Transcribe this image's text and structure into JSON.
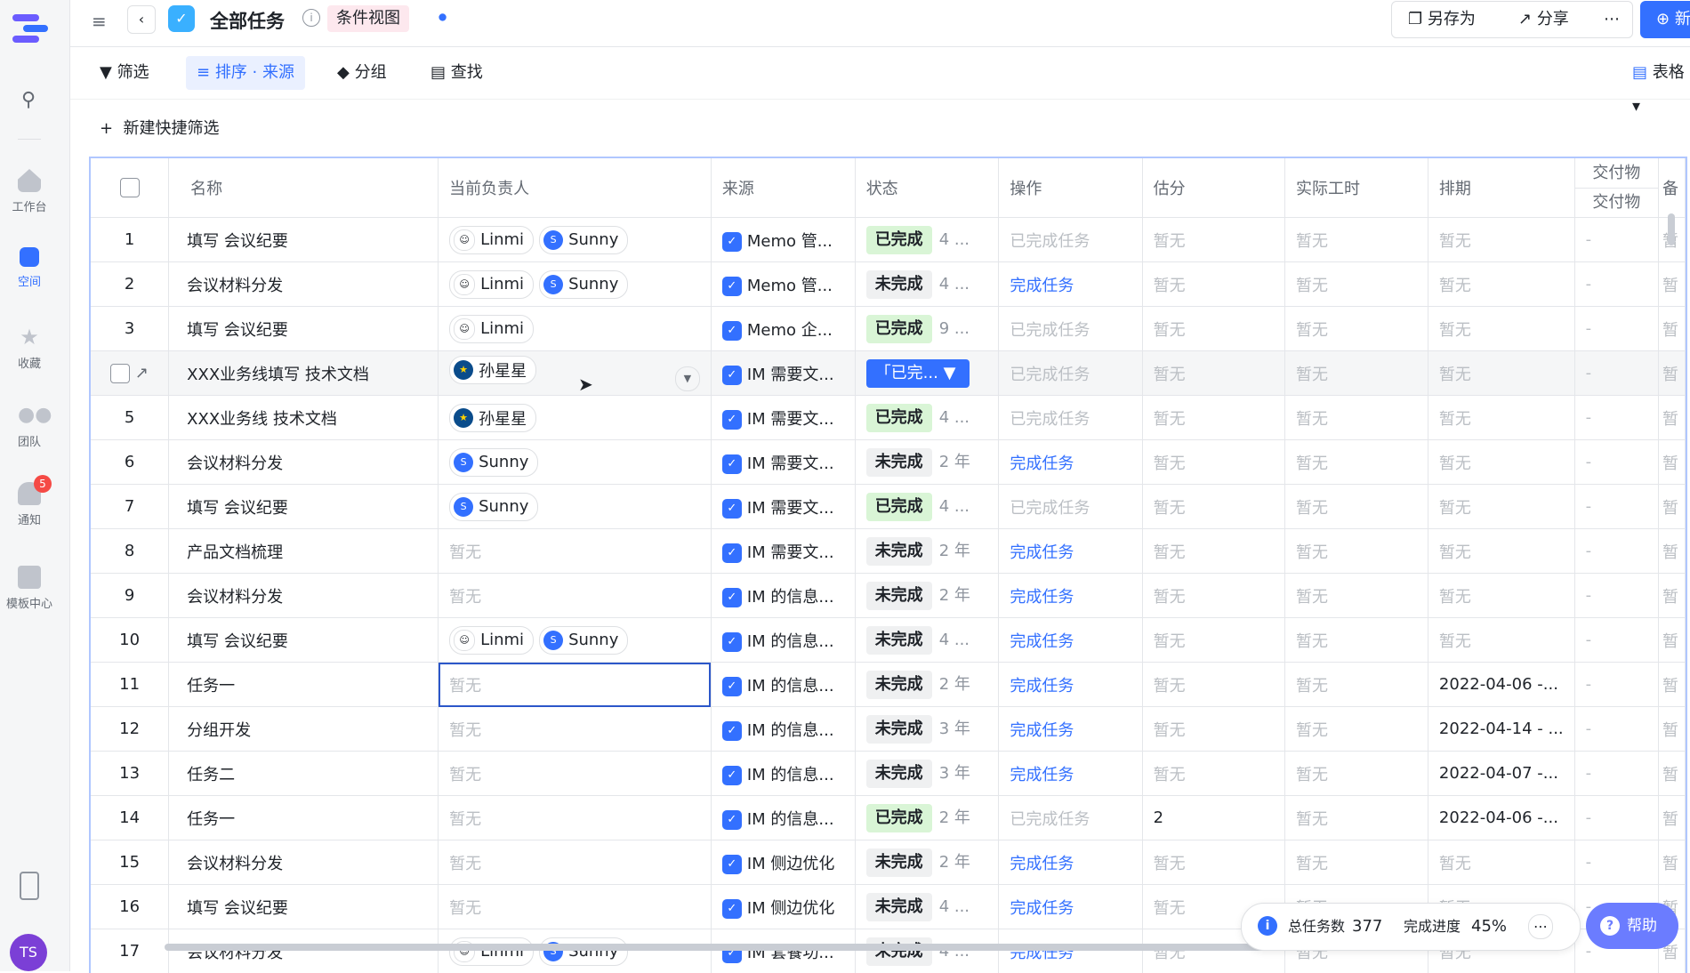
{
  "rail": {
    "items": [
      {
        "label": "工作台",
        "icon": "home-icon"
      },
      {
        "label": "空间",
        "icon": "space-icon"
      },
      {
        "label": "收藏",
        "icon": "star-icon"
      },
      {
        "label": "团队",
        "icon": "team-icon"
      },
      {
        "label": "通知",
        "icon": "bell-icon",
        "badge": "5"
      },
      {
        "label": "模板中心",
        "icon": "template-icon"
      }
    ],
    "avatar": "TS"
  },
  "topbar": {
    "title": "全部任务",
    "view_label": "条件视图",
    "save_as": "另存为",
    "share": "分享",
    "new": "新建"
  },
  "toolbar": {
    "filter": "筛选",
    "sort": "排序 · 来源",
    "group": "分组",
    "find": "查找",
    "view": "表格"
  },
  "quick_filter": "新建快捷筛选",
  "table": {
    "headers": {
      "name": "名称",
      "owner": "当前负责人",
      "source": "来源",
      "status": "状态",
      "action": "操作",
      "estimate": "估分",
      "actual": "实际工时",
      "schedule": "排期",
      "deliver_top": "交付物",
      "deliver_sub": "交付物",
      "extra": "备"
    },
    "rows": [
      {
        "n": "1",
        "name": "填写 会议纪要",
        "owners": [
          "Linmi",
          "Sunny"
        ],
        "source": "Memo 管...",
        "status": "已完成",
        "dur": "4 ...",
        "action": "已完成任务",
        "est": "暂无",
        "act": "暂无",
        "sched": "暂无",
        "deliv": "-",
        "extra": "暂"
      },
      {
        "n": "2",
        "name": "会议材料分发",
        "owners": [
          "Linmi",
          "Sunny"
        ],
        "source": "Memo 管...",
        "status": "未完成",
        "dur": "4 ...",
        "action": "完成任务",
        "est": "暂无",
        "act": "暂无",
        "sched": "暂无",
        "deliv": "-",
        "extra": "暂"
      },
      {
        "n": "3",
        "name": "填写 会议纪要",
        "owners": [
          "Linmi"
        ],
        "source": "Memo 企...",
        "status": "已完成",
        "dur": "9 ...",
        "action": "已完成任务",
        "est": "暂无",
        "act": "暂无",
        "sched": "暂无",
        "deliv": "-",
        "extra": "暂"
      },
      {
        "n": "",
        "name": "XXX业务线填写 技术文档",
        "owners": [
          "孙星星"
        ],
        "source": "IM 需要文...",
        "status": "「已完...",
        "dur": "",
        "action": "已完成任务",
        "est": "暂无",
        "act": "暂无",
        "sched": "暂无",
        "deliv": "-",
        "extra": "暂"
      },
      {
        "n": "5",
        "name": "XXX业务线 技术文档",
        "owners": [
          "孙星星"
        ],
        "source": "IM 需要文...",
        "status": "已完成",
        "dur": "4 ...",
        "action": "已完成任务",
        "est": "暂无",
        "act": "暂无",
        "sched": "暂无",
        "deliv": "-",
        "extra": "暂"
      },
      {
        "n": "6",
        "name": "会议材料分发",
        "owners": [
          "Sunny"
        ],
        "source": "IM 需要文...",
        "status": "未完成",
        "dur": "2 年",
        "action": "完成任务",
        "est": "暂无",
        "act": "暂无",
        "sched": "暂无",
        "deliv": "-",
        "extra": "暂"
      },
      {
        "n": "7",
        "name": "填写 会议纪要",
        "owners": [
          "Sunny"
        ],
        "source": "IM 需要文...",
        "status": "已完成",
        "dur": "4 ...",
        "action": "已完成任务",
        "est": "暂无",
        "act": "暂无",
        "sched": "暂无",
        "deliv": "-",
        "extra": "暂"
      },
      {
        "n": "8",
        "name": "产品文档梳理",
        "owners": [],
        "source": "IM 需要文...",
        "status": "未完成",
        "dur": "2 年",
        "action": "完成任务",
        "est": "暂无",
        "act": "暂无",
        "sched": "暂无",
        "deliv": "-",
        "extra": "暂"
      },
      {
        "n": "9",
        "name": "会议材料分发",
        "owners": [],
        "source": "IM 的信息...",
        "status": "未完成",
        "dur": "2 年",
        "action": "完成任务",
        "est": "暂无",
        "act": "暂无",
        "sched": "暂无",
        "deliv": "-",
        "extra": "暂"
      },
      {
        "n": "10",
        "name": "填写 会议纪要",
        "owners": [
          "Linmi",
          "Sunny"
        ],
        "source": "IM 的信息...",
        "status": "未完成",
        "dur": "4 ...",
        "action": "完成任务",
        "est": "暂无",
        "act": "暂无",
        "sched": "暂无",
        "deliv": "-",
        "extra": "暂"
      },
      {
        "n": "11",
        "name": "任务一",
        "owners": [],
        "source": "IM 的信息...",
        "status": "未完成",
        "dur": "2 年",
        "action": "完成任务",
        "est": "暂无",
        "act": "暂无",
        "sched": "2022-04-06 -...",
        "deliv": "-",
        "extra": "暂"
      },
      {
        "n": "12",
        "name": "分组开发",
        "owners": [],
        "source": "IM 的信息...",
        "status": "未完成",
        "dur": "3 年",
        "action": "完成任务",
        "est": "暂无",
        "act": "暂无",
        "sched": "2022-04-14 - ...",
        "deliv": "-",
        "extra": "暂"
      },
      {
        "n": "13",
        "name": "任务二",
        "owners": [],
        "source": "IM 的信息...",
        "status": "未完成",
        "dur": "3 年",
        "action": "完成任务",
        "est": "暂无",
        "act": "暂无",
        "sched": "2022-04-07 -...",
        "deliv": "-",
        "extra": "暂"
      },
      {
        "n": "14",
        "name": "任务一",
        "owners": [],
        "source": "IM 的信息...",
        "status": "已完成",
        "dur": "2 年",
        "action": "已完成任务",
        "est": "2",
        "act": "暂无",
        "sched": "2022-04-06 -...",
        "deliv": "-",
        "extra": "暂"
      },
      {
        "n": "15",
        "name": "会议材料分发",
        "owners": [],
        "source": "IM 侧边优化",
        "status": "未完成",
        "dur": "2 年",
        "action": "完成任务",
        "est": "暂无",
        "act": "暂无",
        "sched": "暂无",
        "deliv": "-",
        "extra": "暂"
      },
      {
        "n": "16",
        "name": "填写 会议纪要",
        "owners": [],
        "source": "IM 侧边优化",
        "status": "未完成",
        "dur": "4 ...",
        "action": "完成任务",
        "est": "暂无",
        "act": "暂无",
        "sched": "暂无",
        "deliv": "-",
        "extra": "暂"
      },
      {
        "n": "17",
        "name": "会议材料分发",
        "owners": [
          "Linmi",
          "Sunny"
        ],
        "source": "IM 套餐功...",
        "status": "未完成",
        "dur": "4 ...",
        "action": "完成任务",
        "est": "暂无",
        "act": "暂无",
        "sched": "暂无",
        "deliv": "-",
        "extra": "暂"
      }
    ],
    "empty_text": "暂无"
  },
  "stats": {
    "total_label": "总任务数",
    "total": "377",
    "progress_label": "完成进度",
    "progress": "45%"
  },
  "help": "帮助",
  "colors": {
    "accent": "#3370ff",
    "done_bg": "#d9f5d6",
    "todo_bg": "#eff0f1"
  }
}
